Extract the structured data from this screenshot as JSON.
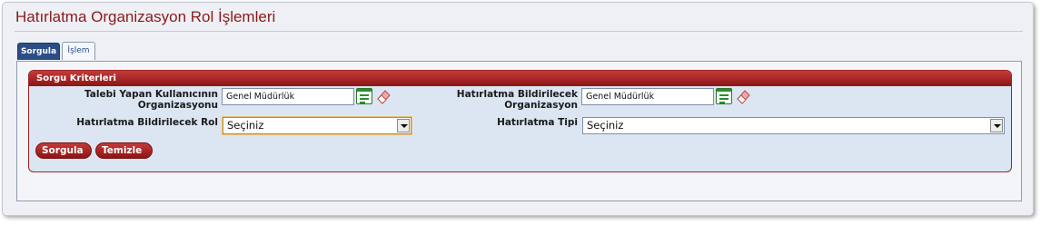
{
  "page": {
    "title": "Hatırlatma Organizasyon Rol İşlemleri"
  },
  "tabs": [
    {
      "label": "Sorgula",
      "active": true
    },
    {
      "label": "İşlem",
      "active": false
    }
  ],
  "criteria": {
    "header": "Sorgu Kriterleri",
    "requesting_org": {
      "label_line1": "Talebi Yapan Kullanıcının",
      "label_line2": "Organizasyonu",
      "value": "Genel Müdürlük"
    },
    "notify_org": {
      "label_line1": "Hatırlatma Bildirilecek",
      "label_line2": "Organizasyon",
      "value": "Genel Müdürlük"
    },
    "notify_role": {
      "label": "Hatırlatma Bildirilecek Rol",
      "selected": "Seçiniz"
    },
    "reminder_type": {
      "label": "Hatırlatma Tipi",
      "selected": "Seçiniz"
    }
  },
  "buttons": {
    "query": "Sorgula",
    "clear": "Temizle"
  },
  "colors": {
    "accent_red": "#8b1a1a",
    "tab_blue": "#2c4e86",
    "box_bg": "#dce5f2"
  },
  "icons": {
    "list": "list-picker-icon",
    "clear": "eraser-icon",
    "dropdown": "chevron-down-icon"
  }
}
